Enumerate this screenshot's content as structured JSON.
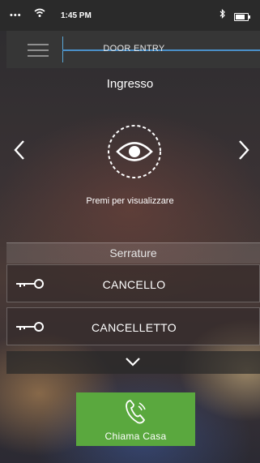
{
  "status_bar": {
    "signal": "•••",
    "time": "1:45 PM"
  },
  "header": {
    "title": "DOOR ENTRY"
  },
  "entrance": {
    "name": "Ingresso",
    "view_caption": "Premi per visualizzare",
    "prev_arrow": "‹",
    "next_arrow": "›"
  },
  "locks": {
    "title": "Serrature",
    "items": [
      {
        "label": "CANCELLO"
      },
      {
        "label": "CANCELLETTO"
      }
    ]
  },
  "call": {
    "label": "Chiama Casa"
  },
  "colors": {
    "accent_blue": "#4a90c8",
    "call_green": "#5aa83e",
    "header_bg": "#363636"
  },
  "icons": {
    "menu": "hamburger-icon",
    "view": "eye-icon",
    "lock": "key-icon",
    "expand": "chevron-down-icon",
    "call": "phone-icon"
  }
}
